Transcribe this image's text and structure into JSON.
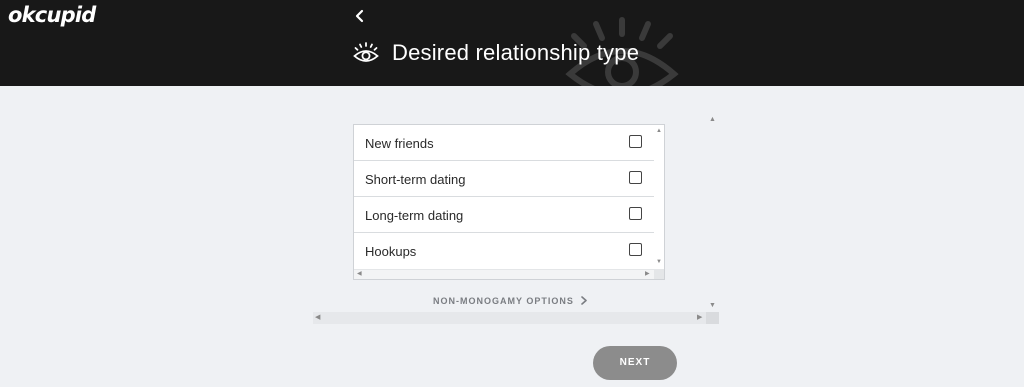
{
  "app": {
    "logo_text": "okcupid"
  },
  "header": {
    "back_icon": "chevron-left-icon",
    "title_icon": "eye-icon",
    "title": "Desired relationship type"
  },
  "options": [
    {
      "label": "New friends",
      "checked": false
    },
    {
      "label": "Short-term dating",
      "checked": false
    },
    {
      "label": "Long-term dating",
      "checked": false
    },
    {
      "label": "Hookups",
      "checked": false
    }
  ],
  "non_monogamy_link": "NON-MONOGAMY OPTIONS",
  "next_button": "NEXT",
  "colors": {
    "header_bg": "#181818",
    "page_bg": "#eff1f4",
    "next_button_bg": "#8c8c8c"
  }
}
